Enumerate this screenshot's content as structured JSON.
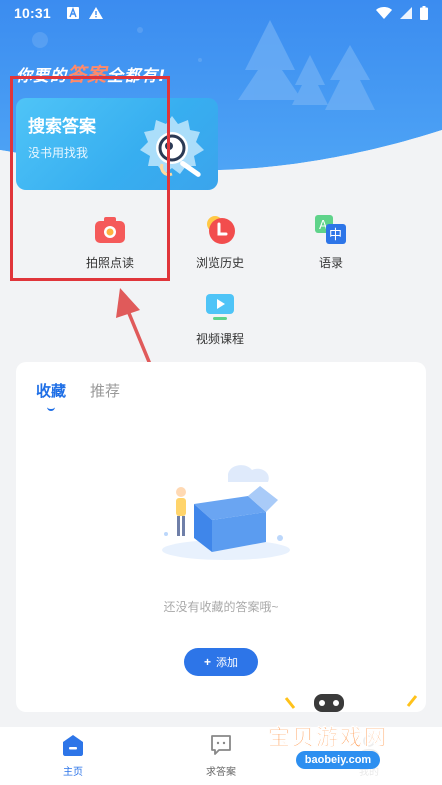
{
  "statusbar": {
    "time": "10:31"
  },
  "hero": {
    "slogan_before": "你要的",
    "slogan_accent": "答案",
    "slogan_after": "全都有!"
  },
  "search_card": {
    "title": "搜索答案",
    "subtitle": "没书用找我"
  },
  "quick_actions": [
    {
      "label": "拍照点读",
      "icon": "camera-icon"
    },
    {
      "label": "浏览历史",
      "icon": "history-icon"
    },
    {
      "label": "语录",
      "icon": "quotes-icon"
    },
    {
      "label": "视频课程",
      "icon": "video-icon"
    }
  ],
  "panel": {
    "tabs": [
      "收藏",
      "推荐"
    ],
    "active_tab": "收藏",
    "empty_text": "还没有收藏的答案哦~",
    "add_button": {
      "plus": "+",
      "label": "添加"
    }
  },
  "bottom_nav": [
    {
      "label": "主页",
      "icon": "home-icon",
      "active": true
    },
    {
      "label": "求答案",
      "icon": "chat-icon",
      "active": false
    },
    {
      "label": "我的",
      "icon": "user-icon",
      "active": false
    }
  ],
  "watermark": {
    "text": "宝贝游戏网",
    "url": "baobeiy.com"
  },
  "colors": {
    "primary": "#2d75e8",
    "hero_top": "#3d8ff1",
    "card": "#4fc4f7",
    "annotation_red": "#e0353a"
  }
}
